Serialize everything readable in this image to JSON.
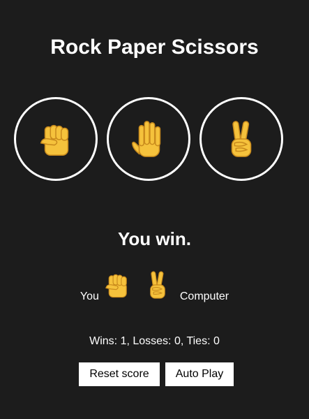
{
  "title": "Rock Paper Scissors",
  "moves": [
    {
      "name": "rock",
      "icon": "raised-fist-icon"
    },
    {
      "name": "paper",
      "icon": "raised-hand-icon"
    },
    {
      "name": "scissors",
      "icon": "victory-hand-icon"
    }
  ],
  "result": {
    "text": "You win.",
    "you_label": "You",
    "you_move_icon": "raised-fist-icon",
    "computer_move_icon": "victory-hand-icon",
    "computer_label": "Computer"
  },
  "score": {
    "text": "Wins: 1, Losses: 0, Ties: 0",
    "wins": 1,
    "losses": 0,
    "ties": 0
  },
  "controls": {
    "reset_label": "Reset score",
    "auto_play_label": "Auto Play"
  },
  "colors": {
    "background": "#1c1c1c",
    "text": "#ffffff",
    "button_bg": "#ffffff",
    "button_text": "#000000",
    "emoji_yellow": "#f5c23c"
  }
}
